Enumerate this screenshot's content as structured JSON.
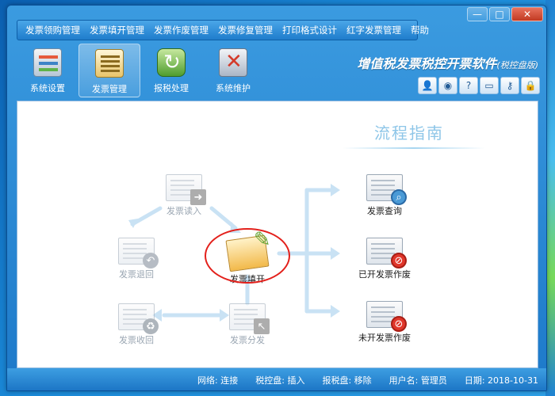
{
  "window": {
    "controls": {
      "minimize": "—",
      "maximize": "□",
      "close": "✕"
    }
  },
  "menu": [
    "发票领购管理",
    "发票填开管理",
    "发票作废管理",
    "发票修复管理",
    "打印格式设计",
    "红字发票管理",
    "帮助"
  ],
  "toolbar": [
    {
      "label": "系统设置",
      "icon": "settings-icon"
    },
    {
      "label": "发票管理",
      "icon": "invoice-icon",
      "active": true
    },
    {
      "label": "报税处理",
      "icon": "tax-icon"
    },
    {
      "label": "系统维护",
      "icon": "maintenance-icon"
    }
  ],
  "brand": {
    "title": "增值税发票税控开票软件",
    "subtitle": "(税控盘版)"
  },
  "quick_buttons": [
    {
      "icon": "user-icon",
      "glyph": "👤"
    },
    {
      "icon": "globe-icon",
      "glyph": "◉"
    },
    {
      "icon": "help-icon",
      "glyph": "?"
    },
    {
      "icon": "window-icon",
      "glyph": "▭"
    },
    {
      "icon": "key-icon",
      "glyph": "⚷"
    },
    {
      "icon": "lock-icon",
      "glyph": "🔒"
    }
  ],
  "guide": {
    "title": "流程指南",
    "nodes": {
      "read_in": "发票读入",
      "return": "发票退回",
      "recover": "发票收回",
      "issue": "发票填开",
      "distribute": "发票分发",
      "query": "发票查询",
      "void_issued": "已开发票作废",
      "void_unissued": "未开发票作废"
    }
  },
  "status": {
    "network": "网络: 连接",
    "tax_disk": "税控盘: 插入",
    "tax_report": "报税盘: 移除",
    "user": "用户名: 管理员",
    "date": "日期: 2018-10-31"
  }
}
